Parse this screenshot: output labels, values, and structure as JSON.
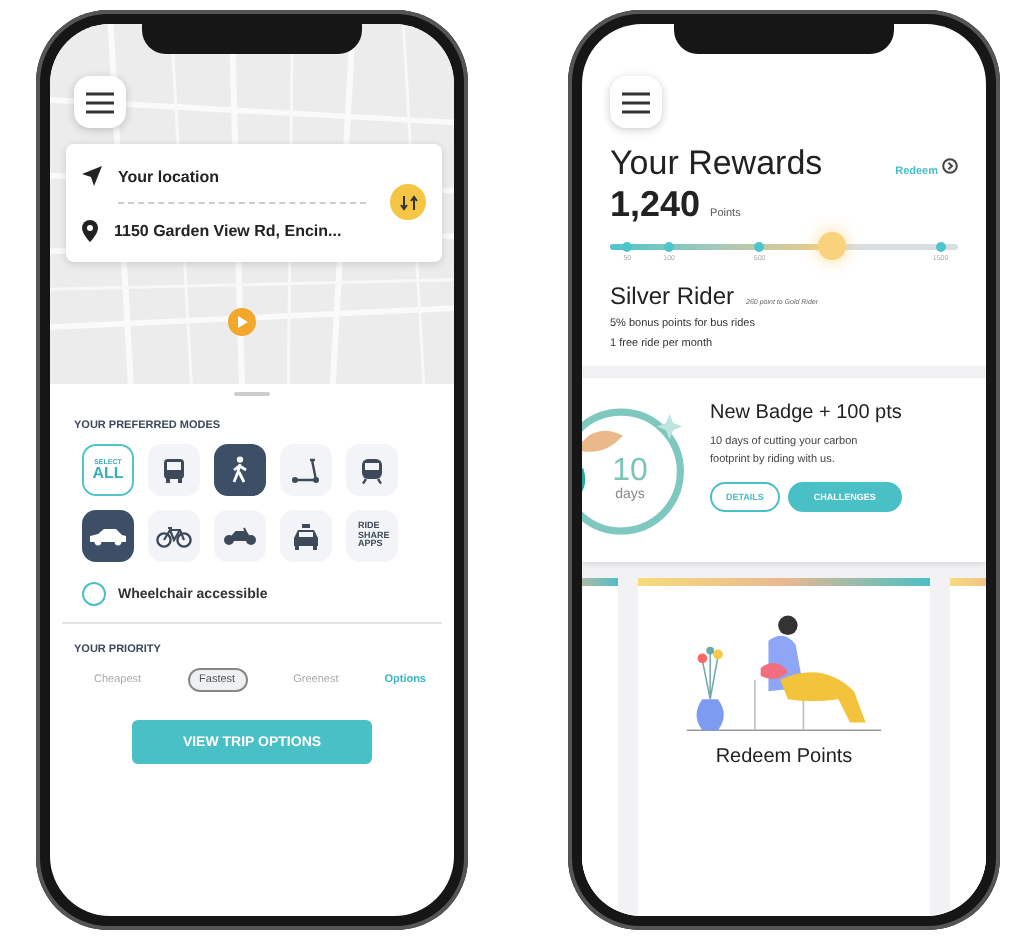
{
  "trip_screen": {
    "location_card": {
      "origin": "Your location",
      "destination": "1150 Garden View Rd, Encin..."
    },
    "modes_heading": "YOUR PREFERRED MODES",
    "modes": [
      {
        "kind": "select_all",
        "small": "SELECT",
        "label": "ALL",
        "selected": true
      },
      {
        "kind": "bus",
        "selected": false
      },
      {
        "kind": "walk",
        "selected": true
      },
      {
        "kind": "scooter",
        "selected": false
      },
      {
        "kind": "train",
        "selected": false
      },
      {
        "kind": "car",
        "selected": true
      },
      {
        "kind": "bike",
        "selected": false
      },
      {
        "kind": "motorcycle",
        "selected": false
      },
      {
        "kind": "taxi",
        "selected": false
      },
      {
        "kind": "text",
        "label": "RIDE SHARE APPS",
        "selected": false
      }
    ],
    "wheelchair": {
      "label": "Wheelchair accessible",
      "checked": false
    },
    "priority_heading": "YOUR PRIORITY",
    "priorities": [
      {
        "label": "Cheapest",
        "selected": false
      },
      {
        "label": "Fastest",
        "selected": true
      },
      {
        "label": "Greenest",
        "selected": false
      }
    ],
    "options_link": "Options",
    "primary_button": "VIEW TRIP OPTIONS"
  },
  "rewards_screen": {
    "title": "Your Rewards",
    "redeem_link": "Redeem",
    "points": "1,240",
    "points_unit": "Points",
    "progress": {
      "level": 0.64,
      "ticks": [
        "50",
        "100",
        "500",
        "1500"
      ]
    },
    "tier": "Silver Rider",
    "tier_note": "260 point to Gold Rider",
    "perks": [
      "5% bonus points for bus rides",
      "1 free ride per month"
    ],
    "badge_card": {
      "badge_number": "10",
      "badge_unit": "days",
      "title": "New Badge + 100 pts",
      "description": "10 days of cutting your carbon footprint by riding with us.",
      "buttons": [
        {
          "label": "DETAILS",
          "kind": "outline"
        },
        {
          "label": "CHALLENGES",
          "kind": "filled"
        }
      ]
    },
    "carousel_card": {
      "title": "Redeem Points"
    }
  }
}
